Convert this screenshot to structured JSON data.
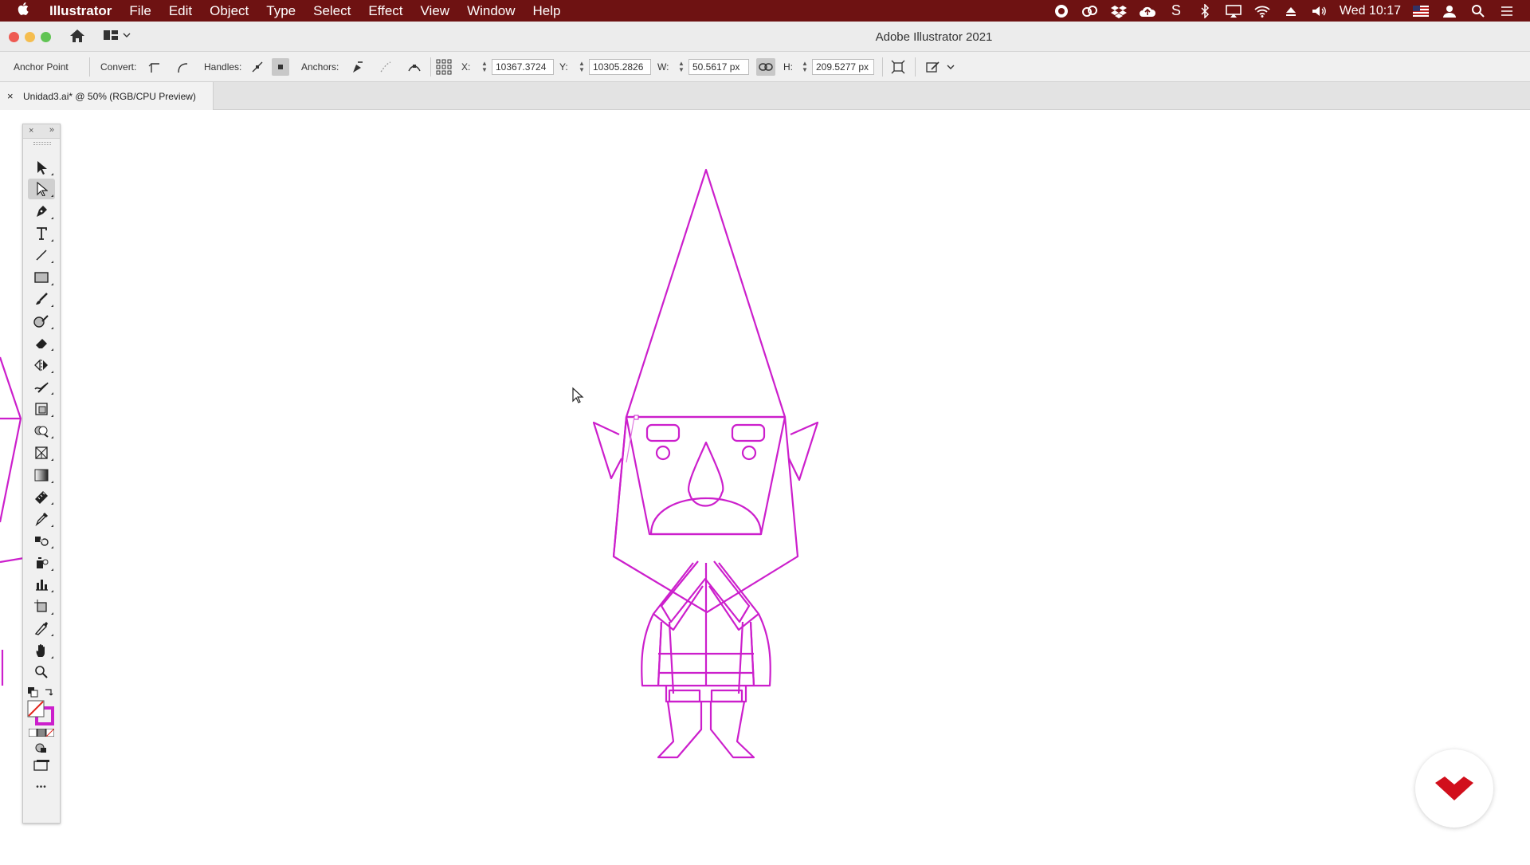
{
  "menubar": {
    "app_name": "Illustrator",
    "items": [
      "File",
      "Edit",
      "Object",
      "Type",
      "Select",
      "Effect",
      "View",
      "Window",
      "Help"
    ],
    "clock": "Wed 10:17",
    "status_icons": [
      "record-icon",
      "creative-cloud-icon",
      "dropbox-icon",
      "cloud-upload-icon",
      "s-icon",
      "bluetooth-icon",
      "airplay-icon",
      "wifi-icon",
      "eject-icon",
      "volume-icon",
      "flag-icon",
      "user-icon",
      "spotlight-icon",
      "control-center-icon"
    ]
  },
  "window": {
    "title": "Adobe Illustrator 2021",
    "traffic_colors": [
      "#ee5a52",
      "#f5bd4f",
      "#61c454"
    ]
  },
  "control_bar": {
    "tool_label": "Anchor Point",
    "convert_label": "Convert:",
    "handles_label": "Handles:",
    "anchors_label": "Anchors:",
    "x_label": "X:",
    "x_value": "10367.3724",
    "y_label": "Y:",
    "y_value": "10305.2826",
    "w_label": "W:",
    "w_value": "50.5617 px",
    "h_label": "H:",
    "h_value": "209.5277 px"
  },
  "document_tab": {
    "close_glyph": "×",
    "name": "Unidad3.ai* @ 50% (RGB/CPU Preview)"
  },
  "toolbar": {
    "tools": [
      "selection-tool-icon",
      "direct-selection-tool-icon",
      "pen-tool-icon",
      "type-tool-icon",
      "line-segment-tool-icon",
      "rectangle-tool-icon",
      "paintbrush-tool-icon",
      "shaper-tool-icon",
      "eraser-tool-icon",
      "reflect-tool-icon",
      "warp-tool-icon",
      "free-transform-tool-icon",
      "shape-builder-tool-icon",
      "perspective-grid-tool-icon",
      "gradient-tool-icon",
      "measure-tool-icon",
      "eyedropper-tool-icon",
      "blend-tool-icon",
      "symbol-sprayer-tool-icon",
      "graph-tool-icon",
      "artboard-tool-icon",
      "slice-tool-icon",
      "hand-tool-icon",
      "zoom-tool-icon"
    ],
    "selected_tool": "direct-selection-tool-icon",
    "more_glyph": "•••"
  },
  "artwork": {
    "stroke_color": "#cc1fcc"
  },
  "brand": {
    "badge_color": "#d10f1c"
  }
}
